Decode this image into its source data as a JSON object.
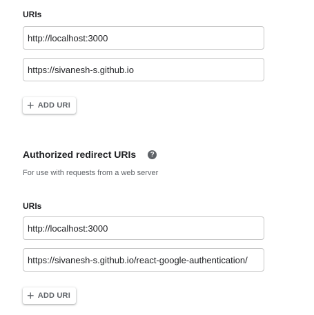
{
  "origins": {
    "uris_label": "URIs",
    "uris": [
      "http://localhost:3000",
      "https://sivanesh-s.github.io"
    ],
    "add_button_label": "ADD URI",
    "add_button_icon": "plus-icon"
  },
  "redirects": {
    "title": "Authorized redirect URIs",
    "help_icon": "help-icon",
    "help_glyph": "?",
    "subtitle": "For use with requests from a web server",
    "uris_label": "URIs",
    "uris": [
      "http://localhost:3000",
      "https://sivanesh-s.github.io/react-google-authentication/"
    ],
    "add_button_label": "ADD URI",
    "add_button_icon": "plus-icon"
  },
  "colors": {
    "text_primary": "#202124",
    "text_secondary": "#5f6368",
    "input_border": "#c7c7c7",
    "background": "#ffffff"
  }
}
